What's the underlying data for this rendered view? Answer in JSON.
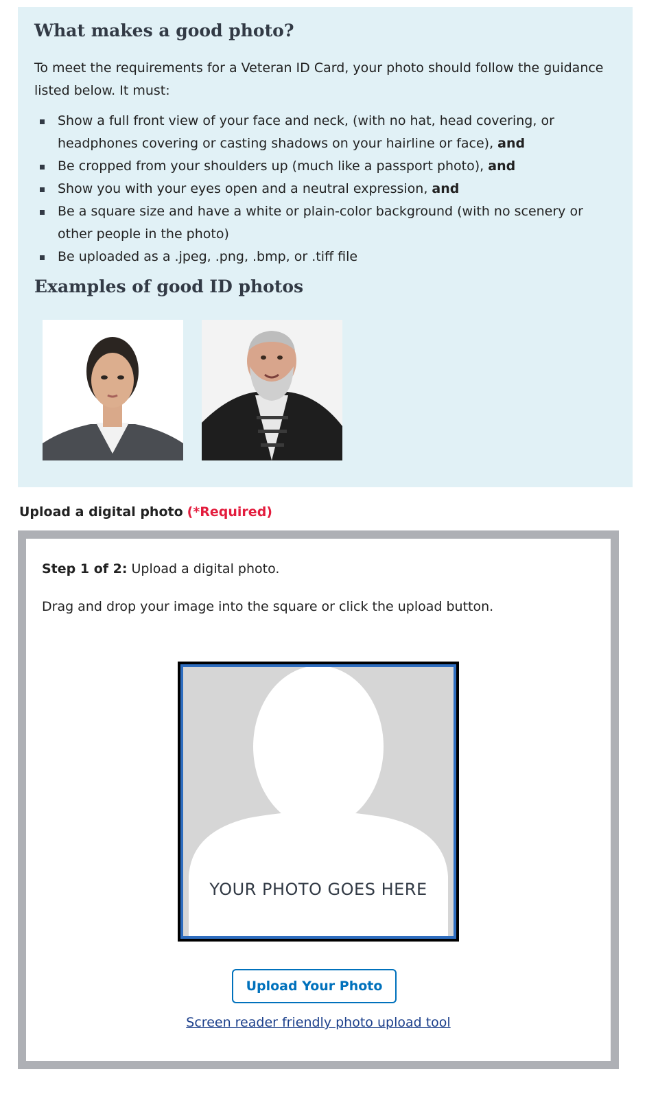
{
  "guidance": {
    "title": "What makes a good photo?",
    "intro": "To meet the requirements for a Veteran ID Card, your photo should follow the guidance listed below. It must:",
    "requirements": [
      {
        "text": "Show a full front view of your face and neck, (with no hat, head covering, or headphones covering or casting shadows on your hairline or face), ",
        "bold": "and"
      },
      {
        "text": "Be cropped from your shoulders up (much like a passport photo), ",
        "bold": "and"
      },
      {
        "text": "Show you with your eyes open and a neutral expression, ",
        "bold": "and"
      },
      {
        "text": "Be a square size and have a white or plain-color background (with no scenery or other people in the photo)",
        "bold": ""
      },
      {
        "text": "Be uploaded as a .jpeg, .png, .bmp, or .tiff file",
        "bold": ""
      }
    ],
    "examples_title": "Examples of good ID photos"
  },
  "upload": {
    "label": "Upload a digital photo",
    "required": "(*Required)",
    "step_prefix": "Step 1 of 2:",
    "step_text": " Upload a digital photo.",
    "instructions": "Drag and drop your image into the square or click the upload button.",
    "placeholder_text": "YOUR PHOTO GOES HERE",
    "button_label": "Upload Your Photo",
    "sr_link": "Screen reader friendly photo upload tool"
  },
  "colors": {
    "guidance_bg": "#e1f1f6",
    "required": "#e31c3d",
    "primary": "#0071bc",
    "drop_border": "#2e6dbf",
    "box_border": "#aeb0b5"
  }
}
